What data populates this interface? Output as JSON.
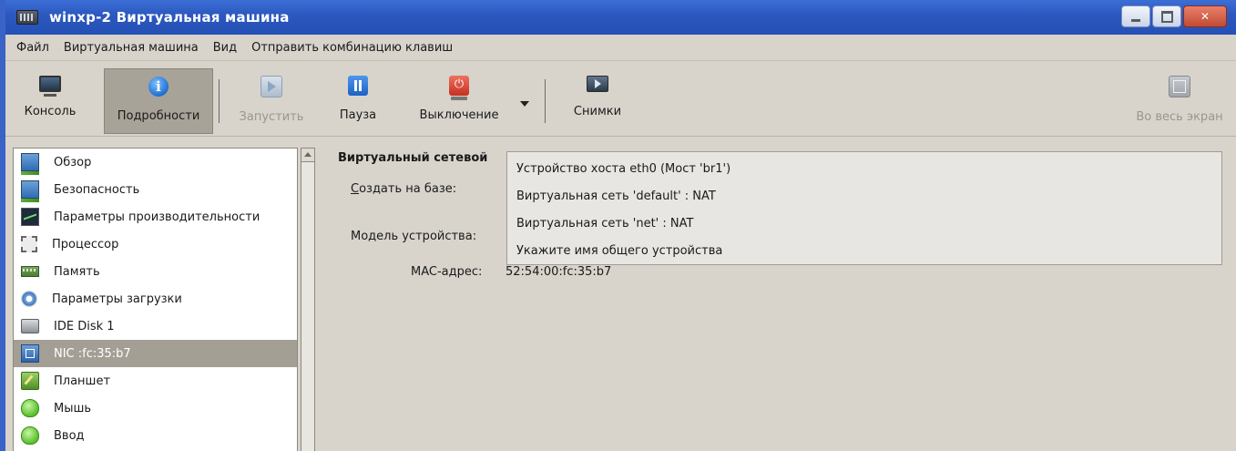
{
  "window": {
    "title": "winxp-2 Виртуальная машина"
  },
  "menu": {
    "file": "Файл",
    "vm": "Виртуальная машина",
    "view": "Вид",
    "send_keys": "Отправить комбинацию клавиш"
  },
  "toolbar": {
    "console": "Консоль",
    "details": "Подробности",
    "run": "Запустить",
    "pause": "Пауза",
    "shutdown": "Выключение",
    "snapshots": "Снимки",
    "fullscreen": "Во весь экран"
  },
  "sidebar": {
    "items": [
      {
        "label": "Обзор",
        "icon": "monitor-icon"
      },
      {
        "label": "Безопасность",
        "icon": "monitor-icon"
      },
      {
        "label": "Параметры производительности",
        "icon": "performance-icon"
      },
      {
        "label": "Процессор",
        "icon": "cpu-icon"
      },
      {
        "label": "Память",
        "icon": "memory-icon"
      },
      {
        "label": "Параметры загрузки",
        "icon": "boot-gear-icon"
      },
      {
        "label": "IDE Disk 1",
        "icon": "disk-icon"
      },
      {
        "label": "NIC :fc:35:b7",
        "icon": "nic-icon",
        "selected": true
      },
      {
        "label": "Планшет",
        "icon": "tablet-icon"
      },
      {
        "label": "Мышь",
        "icon": "mouse-icon"
      },
      {
        "label": "Ввод",
        "icon": "mouse-icon"
      }
    ]
  },
  "details": {
    "heading": "Виртуальный сетевой",
    "source_label": "Создать на базе:",
    "model_label": "Модель устройства:",
    "mac_label": "MAC-адрес:",
    "mac_value": "52:54:00:fc:35:b7"
  },
  "popup": {
    "options": [
      "Устройство хоста eth0 (Мост 'br1')",
      "Виртуальная сеть 'default' : NAT",
      "Виртуальная сеть 'net' : NAT",
      "Укажите имя общего устройства"
    ]
  },
  "colors": {
    "titlebar": "#2c59c0",
    "selected_row": "#a39f95",
    "background": "#d8d4cc"
  }
}
